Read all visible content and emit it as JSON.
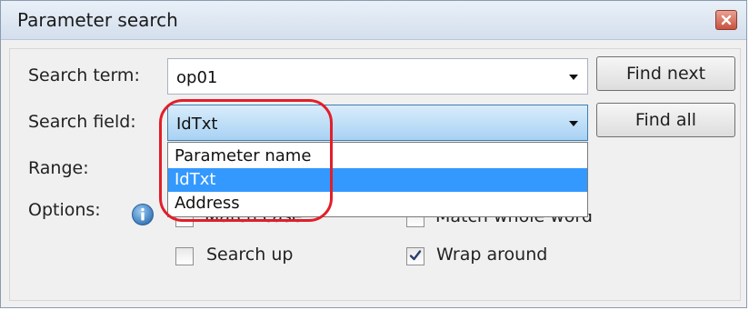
{
  "window": {
    "title": "Parameter search"
  },
  "labels": {
    "search_term": "Search term:",
    "search_field": "Search field:",
    "range": "Range:",
    "options": "Options:"
  },
  "search_term": {
    "value": "op01"
  },
  "search_field": {
    "value": "IdTxt",
    "options": [
      "Parameter name",
      "IdTxt",
      "Address"
    ],
    "selected_index": 1
  },
  "buttons": {
    "find_next": "Find next",
    "find_all": "Find all"
  },
  "options": {
    "match_case_partial": "Match case",
    "match_whole_partial": "Match whole word",
    "search_up": "Search up",
    "search_up_checked": false,
    "wrap_around": "Wrap around",
    "wrap_around_checked": true
  },
  "colors": {
    "highlight": "#e21e2a",
    "selection": "#3399ff"
  },
  "icons": {
    "info": "info-icon",
    "close": "close-icon",
    "check": "checkmark-icon"
  }
}
